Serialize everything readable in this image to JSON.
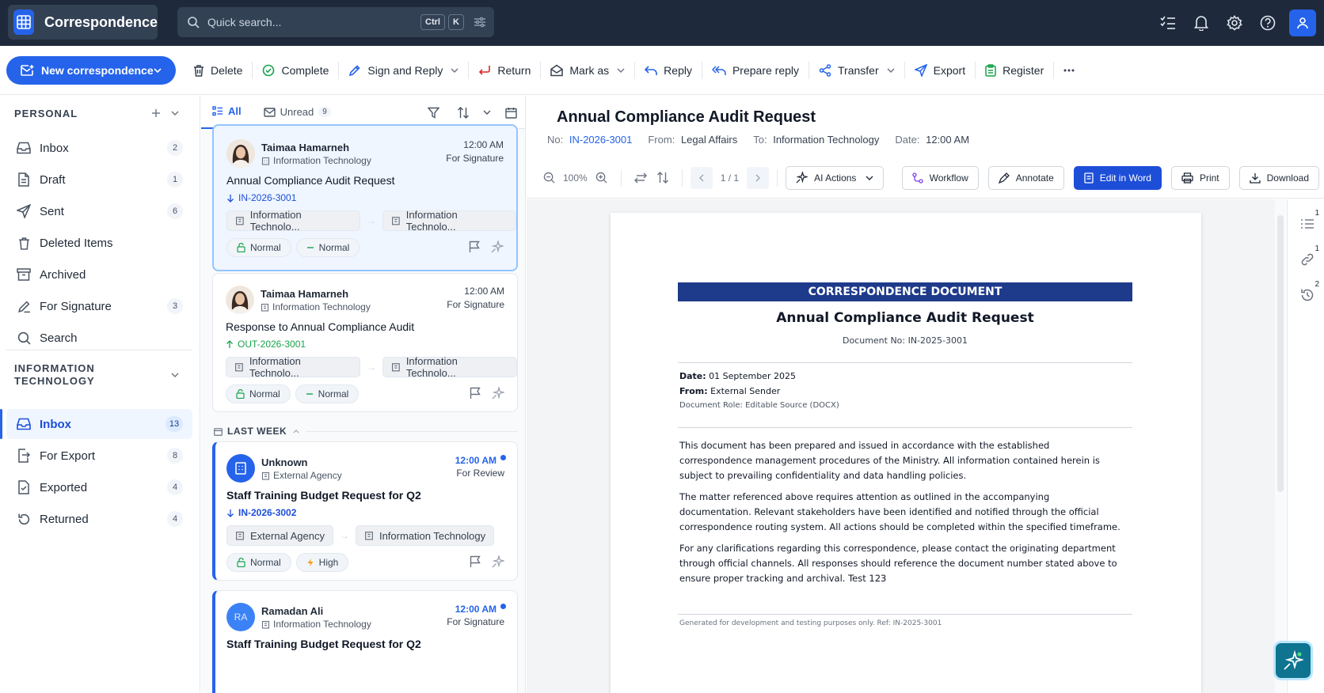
{
  "app": {
    "title": "Correspondence"
  },
  "search": {
    "placeholder": "Quick search...",
    "kbd1": "Ctrl",
    "kbd2": "K"
  },
  "toolbar": {
    "new_label": "New correspondence",
    "delete": "Delete",
    "complete": "Complete",
    "sign_reply": "Sign and Reply",
    "return": "Return",
    "mark_as": "Mark as",
    "reply": "Reply",
    "prepare_reply": "Prepare reply",
    "transfer": "Transfer",
    "export": "Export",
    "register": "Register"
  },
  "sidebar": {
    "personal_title": "PERSONAL",
    "personal": [
      {
        "label": "Inbox",
        "count": "2"
      },
      {
        "label": "Draft",
        "count": "1"
      },
      {
        "label": "Sent",
        "count": "6"
      },
      {
        "label": "Deleted Items",
        "count": ""
      },
      {
        "label": "Archived",
        "count": ""
      },
      {
        "label": "For Signature",
        "count": "3"
      },
      {
        "label": "Search",
        "count": ""
      }
    ],
    "it_title_1": "INFORMATION",
    "it_title_2": "TECHNOLOGY",
    "it": [
      {
        "label": "Inbox",
        "count": "13"
      },
      {
        "label": "For Export",
        "count": "8"
      },
      {
        "label": "Exported",
        "count": "4"
      },
      {
        "label": "Returned",
        "count": "4"
      }
    ]
  },
  "list": {
    "tab_all": "All",
    "tab_unread": "Unread",
    "unread_count": "9",
    "last_week": "LAST WEEK",
    "cards": [
      {
        "sender": "Taimaa Hamarneh",
        "dept": "Information Technology",
        "time": "12:00 AM",
        "status": "For Signature",
        "subject": "Annual Compliance Audit Request",
        "ref": "IN-2026-3001",
        "from_chip": "Information Technolo...",
        "to_chip": "Information Technolo...",
        "tag1": "Normal",
        "tag2": "Normal"
      },
      {
        "sender": "Taimaa Hamarneh",
        "dept": "Information Technology",
        "time": "12:00 AM",
        "status": "For Signature",
        "subject": "Response to Annual Compliance Audit",
        "ref": "OUT-2026-3001",
        "from_chip": "Information Technolo...",
        "to_chip": "Information Technolo...",
        "tag1": "Normal",
        "tag2": "Normal"
      },
      {
        "sender": "Unknown",
        "dept": "External Agency",
        "time": "12:00 AM",
        "status": "For Review",
        "subject": "Staff Training Budget Request for Q2",
        "ref": "IN-2026-3002",
        "from_chip": "External Agency",
        "to_chip": "Information Technology",
        "tag1": "Normal",
        "tag2": "High"
      },
      {
        "sender": "Ramadan Ali",
        "initials": "RA",
        "dept": "Information Technology",
        "time": "12:00 AM",
        "status": "For Signature",
        "subject": "Staff Training Budget Request for Q2"
      }
    ]
  },
  "viewer": {
    "title": "Annual Compliance Audit Request",
    "no_label": "No:",
    "no_value": "IN-2026-3001",
    "from_label": "From:",
    "from_value": "Legal Affairs",
    "to_label": "To:",
    "to_value": "Information Technology",
    "date_label": "Date:",
    "date_value": "12:00 AM",
    "zoom": "100%",
    "page_count": "1 / 1",
    "ai_actions": "AI Actions",
    "workflow": "Workflow",
    "annotate": "Annotate",
    "edit_word": "Edit in Word",
    "print": "Print",
    "download": "Download",
    "rail_counts": [
      "1",
      "1",
      "2"
    ]
  },
  "document": {
    "banner": "CORRESPONDENCE DOCUMENT",
    "title": "Annual Compliance Audit Request",
    "doc_no": "Document No: IN-2025-3001",
    "date_label": "Date:",
    "date_value": "01 September 2025",
    "from_label": "From:",
    "from_value": "External Sender",
    "role": "Document Role: Editable Source (DOCX)",
    "p1": "This document has been prepared and issued in accordance with the established correspondence management procedures of the Ministry. All information contained herein is subject to prevailing confidentiality and data handling policies.",
    "p2": "The matter referenced above requires attention as outlined in the accompanying documentation. Relevant stakeholders have been identified and notified through the official correspondence routing system. All actions should be completed within the specified timeframe.",
    "p3": "For any clarifications regarding this correspondence, please contact the originating department through official channels. All responses should reference the document number stated above to ensure proper tracking and archival. Test 123",
    "footer": "Generated for development and testing purposes only.    Ref: IN-2025-3001"
  }
}
